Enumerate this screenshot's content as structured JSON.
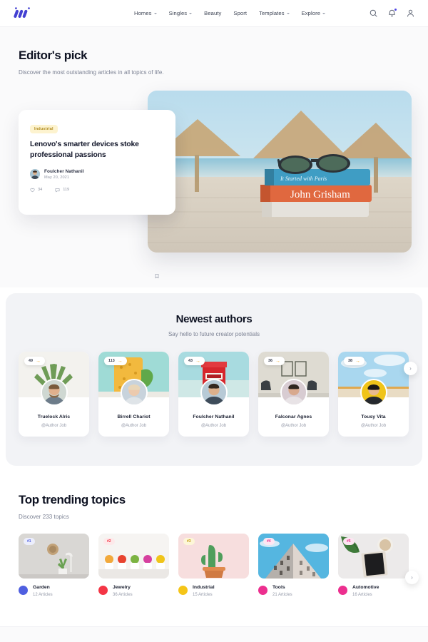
{
  "header": {
    "logo_name": "logo-mark",
    "nav": [
      {
        "label": "Homes",
        "has_caret": true
      },
      {
        "label": "Singles",
        "has_caret": true
      },
      {
        "label": "Beauty",
        "has_caret": false
      },
      {
        "label": "Sport",
        "has_caret": false
      },
      {
        "label": "Templates",
        "has_caret": true
      },
      {
        "label": "Explore",
        "has_caret": true
      }
    ],
    "icons": [
      "search-icon",
      "notification-bell-icon",
      "user-account-icon"
    ],
    "accent": "#4f46e5"
  },
  "editors_pick": {
    "title": "Editor's pick",
    "subtitle": "Discover the most outstanding articles in all topics of life.",
    "card": {
      "tag": "Industrial",
      "title": "Lenovo's smarter devices stoke professional passions",
      "author": "Foulcher Nathanil",
      "date": "May 20, 2021",
      "likes": "34",
      "comments": "119",
      "tag_bg": "#fdf3cf",
      "tag_color": "#b08b1e"
    },
    "prev_label": "←",
    "next_label": "→"
  },
  "authors": {
    "title": "Newest authors",
    "subtitle": "Say hello to future creator potentials",
    "next_label": "›",
    "cards": [
      {
        "count": "49",
        "name": "Truelock Alric",
        "job": "@Author Job"
      },
      {
        "count": "113",
        "name": "Birrell Chariot",
        "job": "@Author Job"
      },
      {
        "count": "43",
        "name": "Foulcher Nathanil",
        "job": "@Author Job"
      },
      {
        "count": "36",
        "name": "Falconar Agnes",
        "job": "@Author Job"
      },
      {
        "count": "38",
        "name": "Tousy Vita",
        "job": "@Author Job"
      }
    ]
  },
  "topics": {
    "title": "Top trending topics",
    "subtitle": "Discover 233 topics",
    "next_label": "›",
    "cards": [
      {
        "rank": "#1",
        "name": "Garden",
        "count": "12 Articles",
        "color": "#4f5fe0",
        "rank_bg": "#eceefc",
        "rank_color": "#4f5fe0"
      },
      {
        "rank": "#2",
        "name": "Jewelry",
        "count": "36 Articles",
        "color": "#f43545",
        "rank_bg": "#fde9ea",
        "rank_color": "#f43545"
      },
      {
        "rank": "#3",
        "name": "Industrial",
        "count": "15 Articles",
        "color": "#f5c518",
        "rank_bg": "#fdf6d8",
        "rank_color": "#c49a0c"
      },
      {
        "rank": "#4",
        "name": "Tools",
        "count": "21 Articles",
        "color": "#ec2f8f",
        "rank_bg": "#fde6f2",
        "rank_color": "#ec2f8f"
      },
      {
        "rank": "#5",
        "name": "Automotive",
        "count": "16 Articles",
        "color": "#ec2f8f",
        "rank_bg": "#fde6f2",
        "rank_color": "#ec2f8f"
      }
    ]
  }
}
